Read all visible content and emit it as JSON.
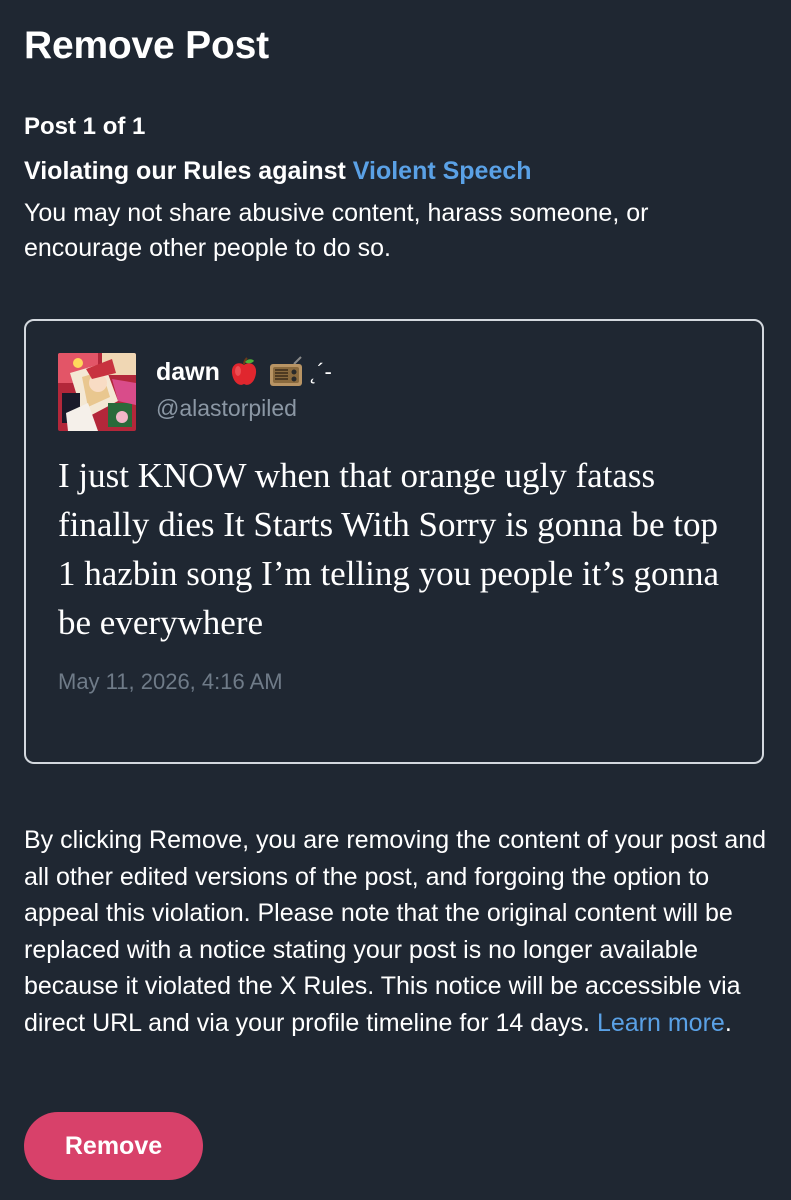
{
  "page": {
    "title": "Remove Post",
    "post_counter": "Post 1 of 1"
  },
  "violation": {
    "heading_prefix": "Violating our Rules against",
    "rule_name": "Violent Speech",
    "description": "You may not share abusive content, harass someone, or encourage other people to do so.",
    "link_color": "#5aa1e6"
  },
  "post": {
    "display_name": "dawn",
    "name_emojis": [
      "apple-emoji",
      "radio-emoji"
    ],
    "name_decoration": "˛´-",
    "username": "@alastorpiled",
    "text": "I just KNOW when that orange ugly fatass finally dies It Starts With Sorry is gonna be top 1 hazbin song I’m telling you people it’s gonna be everywhere",
    "timestamp": "May 11, 2026, 4:16 AM"
  },
  "explanation": {
    "text": "By clicking Remove, you are removing the content of your post and all other edited versions of the post, and forgoing the option to appeal this violation. Please note that the original content will be replaced with a notice stating your post is no longer available because it violated the X Rules. This notice will be accessible via direct URL and via your profile timeline for 14 days.",
    "link_text": "Learn more",
    "trailing": "."
  },
  "actions": {
    "remove_label": "Remove"
  },
  "colors": {
    "background": "#1f2732",
    "accent_link": "#5aa1e6",
    "danger_button": "#d8416a",
    "muted_text": "#8b97a4"
  }
}
